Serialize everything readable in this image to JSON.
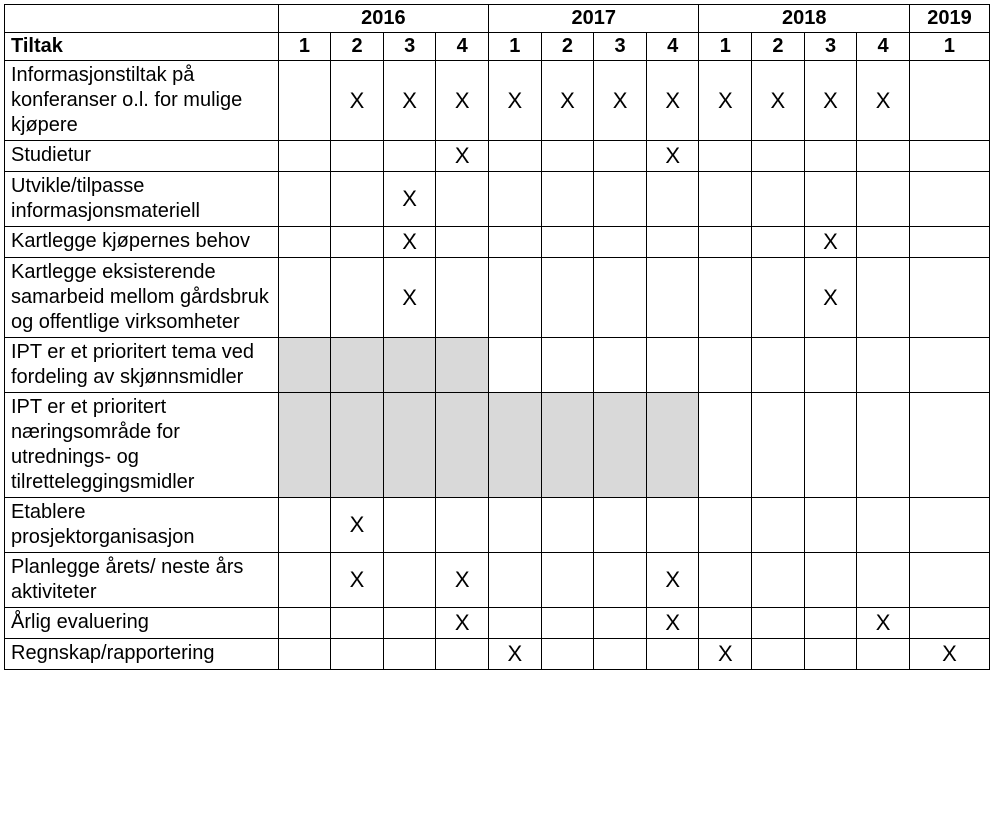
{
  "mark": "X",
  "headers": {
    "tiltak": "Tiltak",
    "years": [
      "2016",
      "2017",
      "2018",
      "2019"
    ],
    "quarters": [
      "1",
      "2",
      "3",
      "4"
    ]
  },
  "rows": [
    {
      "label": "Informasjonstiltak på konferanser o.l. for mulige kjøpere",
      "marks": [
        false,
        true,
        true,
        true,
        true,
        true,
        true,
        true,
        true,
        true,
        true,
        true,
        false
      ],
      "shaded": [
        false,
        false,
        false,
        false,
        false,
        false,
        false,
        false,
        false,
        false,
        false,
        false,
        false
      ]
    },
    {
      "label": "Studietur",
      "marks": [
        false,
        false,
        false,
        true,
        false,
        false,
        false,
        true,
        false,
        false,
        false,
        false,
        false
      ],
      "shaded": [
        false,
        false,
        false,
        false,
        false,
        false,
        false,
        false,
        false,
        false,
        false,
        false,
        false
      ]
    },
    {
      "label": "Utvikle/tilpasse informasjonsmateriell",
      "marks": [
        false,
        false,
        true,
        false,
        false,
        false,
        false,
        false,
        false,
        false,
        false,
        false,
        false
      ],
      "shaded": [
        false,
        false,
        false,
        false,
        false,
        false,
        false,
        false,
        false,
        false,
        false,
        false,
        false
      ]
    },
    {
      "label": "Kartlegge kjøpernes behov",
      "marks": [
        false,
        false,
        true,
        false,
        false,
        false,
        false,
        false,
        false,
        false,
        true,
        false,
        false
      ],
      "shaded": [
        false,
        false,
        false,
        false,
        false,
        false,
        false,
        false,
        false,
        false,
        false,
        false,
        false
      ]
    },
    {
      "label": "Kartlegge eksisterende samarbeid mellom gårdsbruk og offentlige virksomheter",
      "marks": [
        false,
        false,
        true,
        false,
        false,
        false,
        false,
        false,
        false,
        false,
        true,
        false,
        false
      ],
      "shaded": [
        false,
        false,
        false,
        false,
        false,
        false,
        false,
        false,
        false,
        false,
        false,
        false,
        false
      ]
    },
    {
      "label": "IPT er et prioritert tema ved fordeling av skjønnsmidler",
      "marks": [
        false,
        false,
        false,
        false,
        false,
        false,
        false,
        false,
        false,
        false,
        false,
        false,
        false
      ],
      "shaded": [
        true,
        true,
        true,
        true,
        false,
        false,
        false,
        false,
        false,
        false,
        false,
        false,
        false
      ]
    },
    {
      "label": "IPT er et prioritert næringsområde for utrednings- og tilretteleggingsmidler",
      "marks": [
        false,
        false,
        false,
        false,
        false,
        false,
        false,
        false,
        false,
        false,
        false,
        false,
        false
      ],
      "shaded": [
        true,
        true,
        true,
        true,
        true,
        true,
        true,
        true,
        false,
        false,
        false,
        false,
        false
      ]
    },
    {
      "label": "Etablere prosjektorganisasjon",
      "marks": [
        false,
        true,
        false,
        false,
        false,
        false,
        false,
        false,
        false,
        false,
        false,
        false,
        false
      ],
      "shaded": [
        false,
        false,
        false,
        false,
        false,
        false,
        false,
        false,
        false,
        false,
        false,
        false,
        false
      ]
    },
    {
      "label": "Planlegge årets/ neste års aktiviteter",
      "marks": [
        false,
        true,
        false,
        true,
        false,
        false,
        false,
        true,
        false,
        false,
        false,
        false,
        false
      ],
      "shaded": [
        false,
        false,
        false,
        false,
        false,
        false,
        false,
        false,
        false,
        false,
        false,
        false,
        false
      ]
    },
    {
      "label": "Årlig evaluering",
      "marks": [
        false,
        false,
        false,
        true,
        false,
        false,
        false,
        true,
        false,
        false,
        false,
        true,
        false
      ],
      "shaded": [
        false,
        false,
        false,
        false,
        false,
        false,
        false,
        false,
        false,
        false,
        false,
        false,
        false
      ]
    },
    {
      "label": "Regnskap/rapportering",
      "marks": [
        false,
        false,
        false,
        false,
        true,
        false,
        false,
        false,
        true,
        false,
        false,
        false,
        true
      ],
      "shaded": [
        false,
        false,
        false,
        false,
        false,
        false,
        false,
        false,
        false,
        false,
        false,
        false,
        false
      ]
    }
  ]
}
